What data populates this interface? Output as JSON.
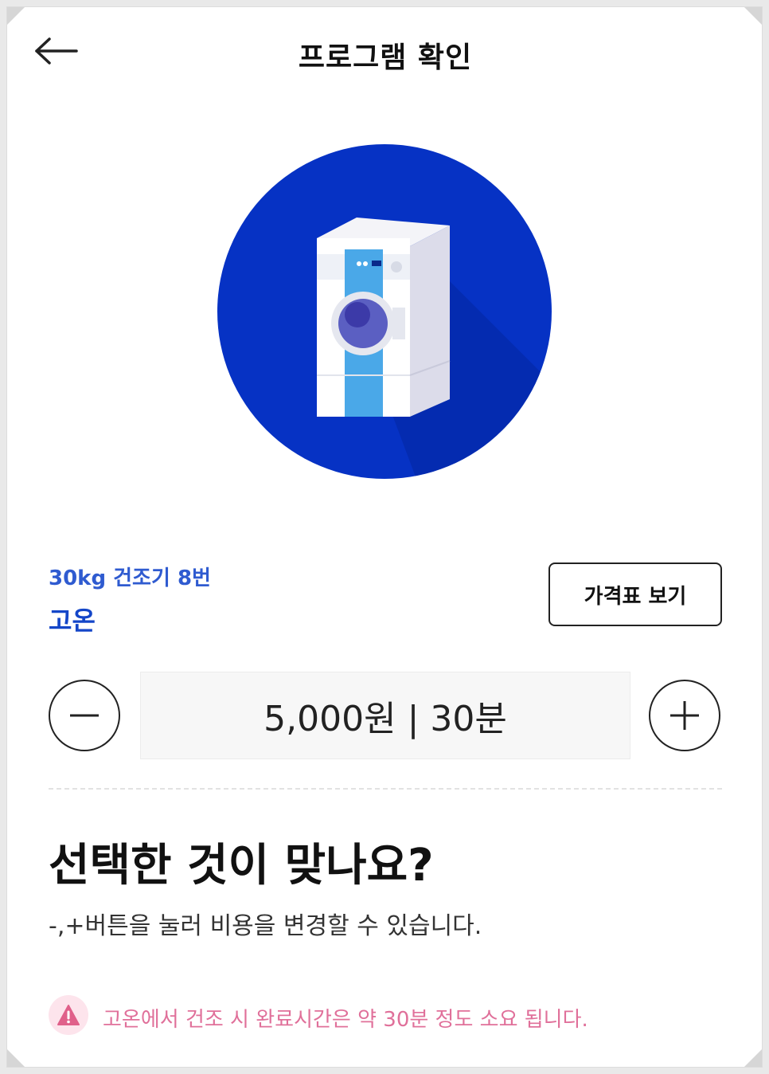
{
  "header": {
    "title": "프로그램 확인",
    "back_icon": "arrow-left-icon"
  },
  "hero": {
    "icon": "dryer-machine-icon",
    "circle_color": "#0632c4"
  },
  "machine": {
    "name": "30kg 건조기 8번",
    "mode": "고온"
  },
  "buttons": {
    "price_table": "가격표 보기"
  },
  "stepper": {
    "value": "5,000원 | 30분",
    "minus_icon": "minus-icon",
    "plus_icon": "plus-icon"
  },
  "confirm": {
    "question": "선택한 것이 맞나요?",
    "hint": "-,+버튼을 눌러 비용을 변경할 수 있습니다."
  },
  "notice": {
    "icon": "warning-icon",
    "text": "고온에서 건조 시 완료시간은 약 30분 정도 소요 됩니다.",
    "color": "#e0709a"
  }
}
